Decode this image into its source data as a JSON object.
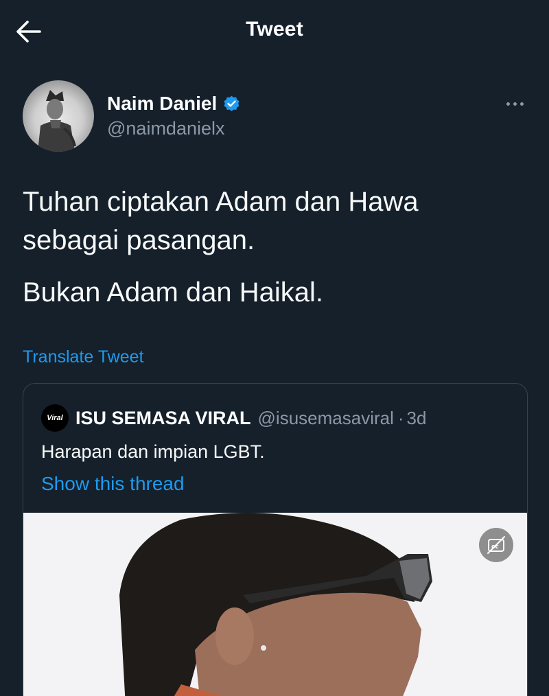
{
  "header": {
    "title": "Tweet"
  },
  "author": {
    "name": "Naim Daniel",
    "handle": "@naimdanielx"
  },
  "tweet": {
    "line1": "Tuhan ciptakan Adam dan Hawa",
    "line2": "sebagai pasangan.",
    "line3": "Bukan Adam dan Haikal.",
    "translate_label": "Translate Tweet"
  },
  "quoted": {
    "avatar_text": "Viral",
    "name": "ISU SEMASA VIRAL",
    "handle": "@isusemasaviral",
    "separator": "·",
    "time": "3d",
    "text": "Harapan dan impian LGBT.",
    "show_thread": "Show this thread"
  },
  "icons": {
    "back": "arrow-left-icon",
    "verified": "verified-badge-icon",
    "more": "more-horizontal-icon",
    "captions": "closed-captions-off-icon"
  },
  "colors": {
    "background": "#15202b",
    "accent": "#1d9bf0",
    "secondary_text": "#8b98a5",
    "border": "#38444d"
  }
}
